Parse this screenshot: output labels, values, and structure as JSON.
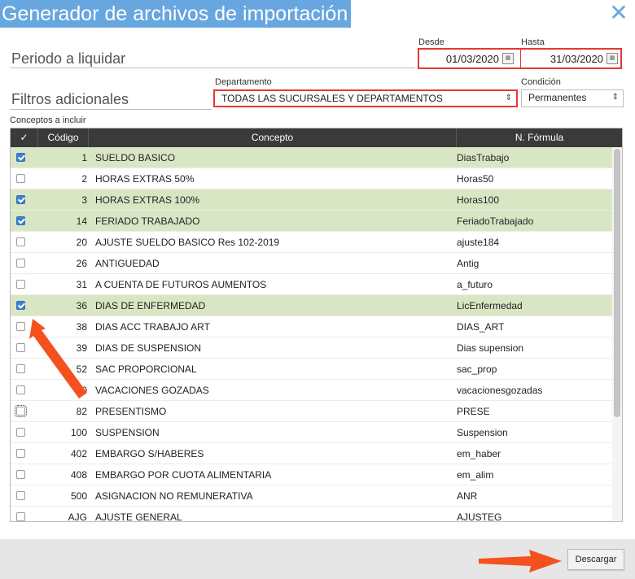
{
  "window": {
    "title": "Generador de archivos de importación",
    "close_icon": "close-icon"
  },
  "periodo": {
    "label": "Periodo a liquidar",
    "desde_label": "Desde",
    "hasta_label": "Hasta",
    "desde_value": "01/03/2020",
    "hasta_value": "31/03/2020"
  },
  "filtros": {
    "label": "Filtros adicionales",
    "departamento_label": "Departamento",
    "departamento_value": "TODAS LAS SUCURSALES Y DEPARTAMENTOS",
    "condicion_label": "Condición",
    "condicion_value": "Permanentes"
  },
  "conceptos": {
    "label": "Conceptos a incluir",
    "columns": {
      "check": "✓",
      "codigo": "Código",
      "concepto": "Concepto",
      "formula": "N. Fórmula"
    },
    "rows": [
      {
        "checked": true,
        "codigo": "1",
        "concepto": "SUELDO BASICO",
        "formula": "DiasTrabajo"
      },
      {
        "checked": false,
        "codigo": "2",
        "concepto": "HORAS EXTRAS 50%",
        "formula": "Horas50"
      },
      {
        "checked": true,
        "codigo": "3",
        "concepto": "HORAS EXTRAS 100%",
        "formula": "Horas100"
      },
      {
        "checked": true,
        "codigo": "14",
        "concepto": "FERIADO TRABAJADO",
        "formula": "FeriadoTrabajado"
      },
      {
        "checked": false,
        "codigo": "20",
        "concepto": "AJUSTE SUELDO BASICO Res 102-2019",
        "formula": "ajuste184"
      },
      {
        "checked": false,
        "codigo": "26",
        "concepto": "ANTIGUEDAD",
        "formula": "Antig"
      },
      {
        "checked": false,
        "codigo": "31",
        "concepto": "A CUENTA DE FUTUROS AUMENTOS",
        "formula": "a_futuro"
      },
      {
        "checked": true,
        "codigo": "36",
        "concepto": "DIAS DE ENFERMEDAD",
        "formula": "LicEnfermedad"
      },
      {
        "checked": false,
        "codigo": "38",
        "concepto": "DIAS ACC TRABAJO ART",
        "formula": "DIAS_ART"
      },
      {
        "checked": false,
        "codigo": "39",
        "concepto": "DIAS DE SUSPENSION",
        "formula": "Dias supension"
      },
      {
        "checked": false,
        "codigo": "52",
        "concepto": "SAC PROPORCIONAL",
        "formula": "sac_prop"
      },
      {
        "checked": false,
        "codigo": "80",
        "concepto": "VACACIONES GOZADAS",
        "formula": "vacacionesgozadas"
      },
      {
        "checked": false,
        "codigo": "82",
        "concepto": "PRESENTISMO",
        "formula": "PRESE"
      },
      {
        "checked": false,
        "codigo": "100",
        "concepto": "SUSPENSION",
        "formula": "Suspension"
      },
      {
        "checked": false,
        "codigo": "402",
        "concepto": "EMBARGO S/HABERES",
        "formula": "em_haber"
      },
      {
        "checked": false,
        "codigo": "408",
        "concepto": "EMBARGO POR CUOTA ALIMENTARIA",
        "formula": "em_alim"
      },
      {
        "checked": false,
        "codigo": "500",
        "concepto": "ASIGNACION NO REMUNERATIVA",
        "formula": "ANR"
      },
      {
        "checked": false,
        "codigo": "AJG",
        "concepto": "AJUSTE GENERAL",
        "formula": "AJUSTEG"
      }
    ]
  },
  "footer": {
    "descargar_label": "Descargar"
  },
  "colors": {
    "title_bg": "#67a6df",
    "highlight": "#e53935",
    "selected_row": "#d9e6c4",
    "annotation_arrow": "#f4511e"
  }
}
